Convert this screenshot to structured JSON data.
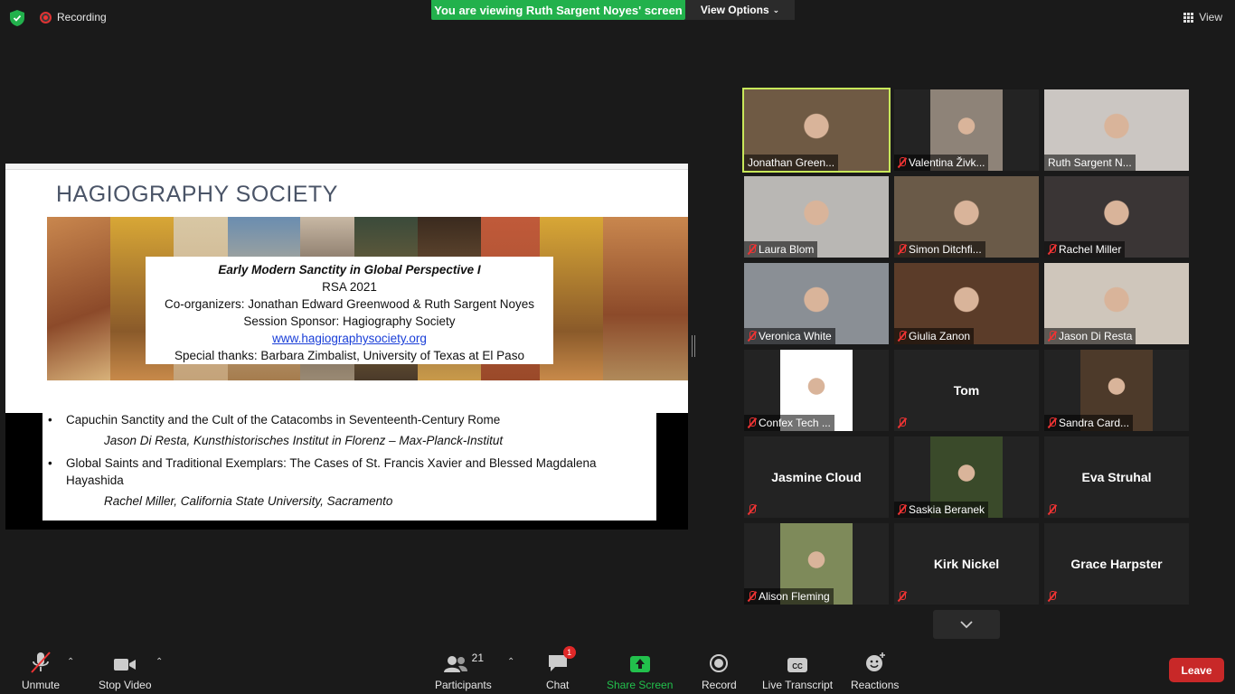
{
  "topbar": {
    "recording_label": "Recording",
    "viewing_banner": "You are viewing Ruth Sargent Noyes' screen",
    "view_options": "View Options",
    "view_label": "View"
  },
  "slide": {
    "title": "HAGIOGRAPHY SOCIETY",
    "session_title": "Early Modern Sanctity in Global Perspective I",
    "conference": "RSA 2021",
    "organizers": "Co-organizers: Jonathan Edward Greenwood & Ruth Sargent Noyes",
    "sponsor": "Session Sponsor: Hagiography Society",
    "website": "www.hagiographysociety.org",
    "thanks": "Special thanks: Barbara Zimbalist, University of Texas at El Paso",
    "talks": [
      {
        "title": "Capuchin Sanctity and the Cult of the Catacombs in Seventeenth-Century Rome",
        "speaker": "Jason Di Resta, Kunsthistorisches Institut in Florenz – Max-Planck-Institut"
      },
      {
        "title": "Global Saints and Traditional Exemplars: The Cases of St. Francis Xavier and Blessed Magdalena Hayashida",
        "speaker": "Rachel Miller, California State University, Sacramento"
      }
    ]
  },
  "participants_gallery": [
    {
      "name": "Jonathan Green...",
      "muted": false,
      "video": true,
      "speaking": true,
      "color": "#6f5a44"
    },
    {
      "name": "Valentina Živk...",
      "muted": true,
      "video": true,
      "color": "#8e8378"
    },
    {
      "name": "Ruth Sargent N...",
      "muted": false,
      "video": true,
      "color": "#cbc6c2"
    },
    {
      "name": "Laura Blom",
      "muted": true,
      "video": true,
      "color": "#b9b7b4"
    },
    {
      "name": "Simon Ditchfi...",
      "muted": true,
      "video": true,
      "color": "#6a5a48"
    },
    {
      "name": "Rachel Miller",
      "muted": true,
      "video": true,
      "color": "#3a3535"
    },
    {
      "name": "Veronica White",
      "muted": true,
      "video": true,
      "color": "#8a8f95"
    },
    {
      "name": "Giulia Zanon",
      "muted": true,
      "video": true,
      "color": "#5b3c29"
    },
    {
      "name": "Jason Di Resta",
      "muted": true,
      "video": true,
      "color": "#cfc6bb"
    },
    {
      "name": "Confex Tech ...",
      "muted": true,
      "video": true,
      "color": "#ffffff"
    },
    {
      "name": "Tom",
      "muted": true,
      "video": false
    },
    {
      "name": "Sandra Card...",
      "muted": true,
      "video": true,
      "color": "#4d3a2a"
    },
    {
      "name": "Jasmine Cloud",
      "muted": true,
      "video": false
    },
    {
      "name": "Saskia Beranek",
      "muted": true,
      "video": true,
      "color": "#3a4a2a"
    },
    {
      "name": "Eva Struhal",
      "muted": true,
      "video": false
    },
    {
      "name": "Alison Fleming",
      "muted": true,
      "video": true,
      "color": "#7e8a5a"
    },
    {
      "name": "Kirk Nickel",
      "muted": true,
      "video": false
    },
    {
      "name": "Grace Harpster",
      "muted": true,
      "video": false
    }
  ],
  "toolbar": {
    "unmute": "Unmute",
    "stop_video": "Stop Video",
    "participants": "Participants",
    "participants_count": "21",
    "chat": "Chat",
    "chat_badge": "1",
    "share_screen": "Share Screen",
    "record": "Record",
    "live_transcript": "Live Transcript",
    "reactions": "Reactions",
    "leave": "Leave"
  }
}
